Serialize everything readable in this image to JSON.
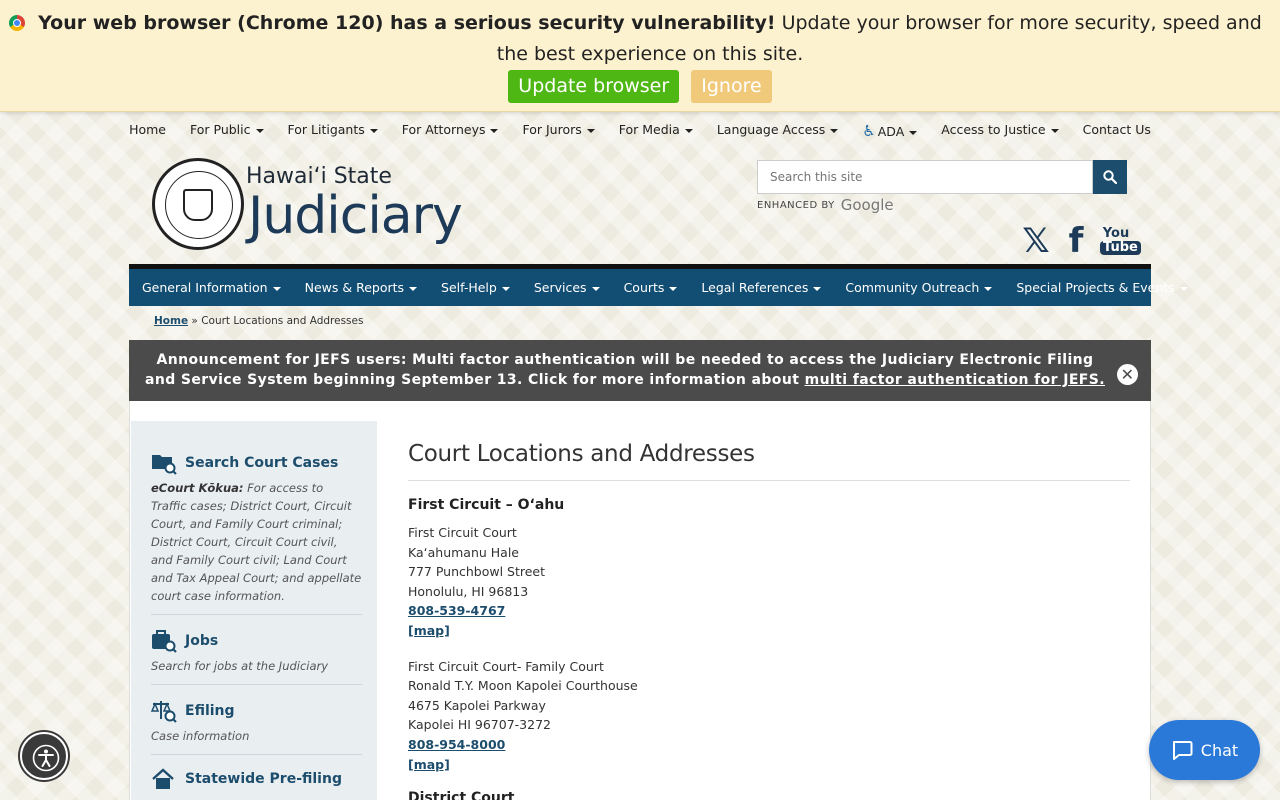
{
  "update_bar": {
    "bold_text": "Your web browser (Chrome 120) has a serious security vulnerability!",
    "text": "Update your browser for more security, speed and the best experience on this site.",
    "update_label": "Update browser",
    "ignore_label": "Ignore"
  },
  "utility_nav": {
    "items": [
      {
        "label": "Home"
      },
      {
        "label": "For Public"
      },
      {
        "label": "For Litigants"
      },
      {
        "label": "For Attorneys"
      },
      {
        "label": "For Jurors"
      },
      {
        "label": "For Media"
      },
      {
        "label": "Language Access"
      },
      {
        "label": "ADA"
      },
      {
        "label": "Access to Justice"
      },
      {
        "label": "Contact Us"
      }
    ]
  },
  "logo": {
    "small": "Hawaiʻi State",
    "big": "Judiciary"
  },
  "search": {
    "placeholder": "Search this site",
    "enhanced_by": "ENHANCED BY",
    "google": "Google"
  },
  "social": {
    "x": "𝕏",
    "facebook": "f",
    "youtube_top": "You",
    "youtube_bottom": "Tube"
  },
  "main_nav": {
    "items": [
      {
        "label": "General Information"
      },
      {
        "label": "News & Reports"
      },
      {
        "label": "Self-Help"
      },
      {
        "label": "Services"
      },
      {
        "label": "Courts"
      },
      {
        "label": "Legal References"
      },
      {
        "label": "Community Outreach"
      },
      {
        "label": "Special Projects & Events"
      }
    ]
  },
  "breadcrumb": {
    "home": "Home",
    "separator": "»",
    "current": "Court Locations and Addresses"
  },
  "announcement": {
    "text": "Announcement for JEFS users: Multi factor authentication will be needed to access the Judiciary Electronic Filing and Service System beginning September 13. Click for more information about",
    "link": "multi factor authentication for JEFS.",
    "close": "✕"
  },
  "sidebar": {
    "items": [
      {
        "title": "Search Court Cases",
        "desc_bold": "eCourt Kōkua:",
        "desc": "For access to Traffic cases; District Court, Circuit Court, and Family Court criminal; District Court, Circuit Court civil, and Family Court civil; Land Court and Tax Appeal Court; and appellate court case information."
      },
      {
        "title": "Jobs",
        "desc": "Search for jobs at the Judiciary"
      },
      {
        "title": "Efiling",
        "desc": "Case information"
      },
      {
        "title": "Statewide Pre-filing"
      }
    ]
  },
  "main": {
    "title": "Court Locations and Addresses",
    "section": "First Circuit – Oʻahu",
    "locations": [
      {
        "lines": [
          "First Circuit Court",
          "Kaʻahumanu Hale",
          "777 Punchbowl Street",
          "Honolulu, HI 96813"
        ],
        "phone": "808-539-4767",
        "map": "[map]"
      },
      {
        "lines": [
          "First Circuit Court- Family Court",
          "Ronald T.Y. Moon Kapolei Courthouse",
          "4675 Kapolei Parkway",
          "Kapolei HI 96707-3272"
        ],
        "phone": "808-954-8000",
        "map": "[map]"
      }
    ],
    "next_heading": "District Court"
  },
  "chat": {
    "label": "Chat"
  },
  "colors": {
    "nav_blue": "#124d73",
    "update_green": "#4fb714",
    "ignore_orange": "#f0c97a",
    "chat_blue": "#2a78d8",
    "announce_gray": "#4b4b4b"
  }
}
